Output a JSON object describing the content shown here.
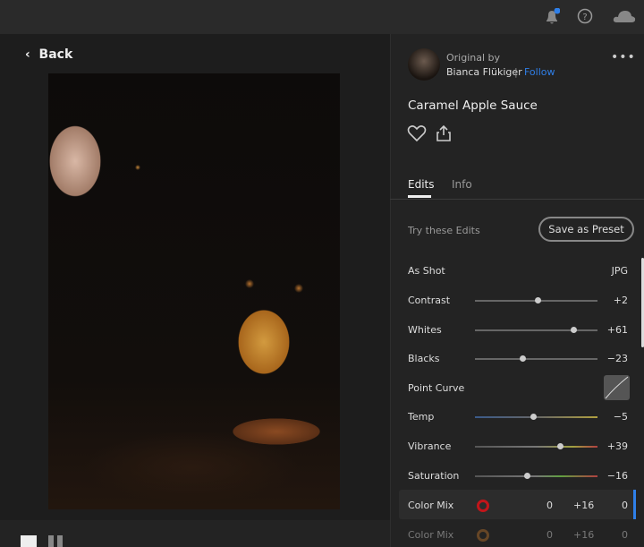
{
  "topbar": {
    "icons": [
      "bell-icon",
      "help-icon",
      "cloud-icon"
    ],
    "notification_color": "#2f7fe8"
  },
  "nav": {
    "back_label": "Back"
  },
  "author": {
    "prefix": "Original by",
    "name": "Bianca Flükiger",
    "separator": "|",
    "follow_label": "Follow"
  },
  "photo": {
    "title": "Caramel Apple Sauce"
  },
  "tabs": [
    {
      "label": "Edits",
      "active": true
    },
    {
      "label": "Info",
      "active": false
    }
  ],
  "edits": {
    "hint": "Try these Edits",
    "preset_button": "Save as Preset",
    "profile": {
      "label": "As Shot",
      "value": "JPG"
    },
    "sliders": [
      {
        "label": "Contrast",
        "value": 2,
        "display": "+2"
      },
      {
        "label": "Whites",
        "value": 61,
        "display": "+61"
      },
      {
        "label": "Blacks",
        "value": -23,
        "display": "−23"
      },
      {
        "label": "Temp",
        "value": -5,
        "display": "−5"
      },
      {
        "label": "Vibrance",
        "value": 39,
        "display": "+39"
      },
      {
        "label": "Saturation",
        "value": -16,
        "display": "−16"
      }
    ],
    "point_curve": {
      "label": "Point Curve"
    },
    "color_mix": [
      {
        "label": "Color Mix",
        "color": "#c2151a",
        "hue": "0",
        "sat": "+16",
        "lum": "0"
      },
      {
        "label": "Color Mix",
        "color": "#b9722a",
        "hue": "0",
        "sat": "+16",
        "lum": "0"
      }
    ]
  }
}
